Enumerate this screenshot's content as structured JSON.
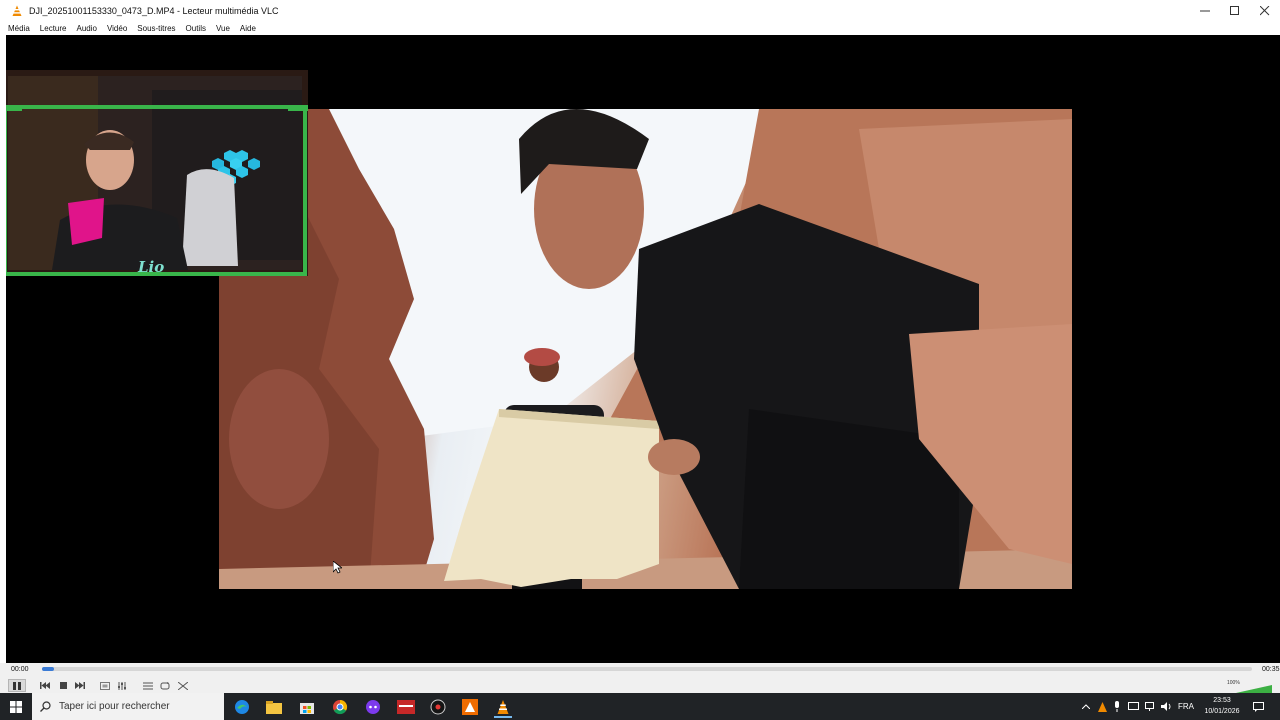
{
  "window": {
    "title": "DJI_20251001153330_0473_D.MP4 - Lecteur multimédia VLC",
    "app_icon": "vlc-cone-icon"
  },
  "menu": [
    "Média",
    "Lecture",
    "Audio",
    "Vidéo",
    "Sous-titres",
    "Outils",
    "Vue",
    "Aide"
  ],
  "overlay": {
    "text": "Lio"
  },
  "player": {
    "time_elapsed": "00:00",
    "time_total": "00:35",
    "progress": 0.01,
    "volume_label": "100%",
    "volume_level": 1.0
  },
  "taskbar": {
    "search_placeholder": "Taper ici pour rechercher",
    "tray_lang": "FRA",
    "clock_time": "23:53",
    "clock_date": "10/01/2026"
  },
  "colors": {
    "accent_orange": "#f08a00",
    "seek_blue": "#3a7bd5",
    "webcam_frame_green": "#39b54a"
  }
}
